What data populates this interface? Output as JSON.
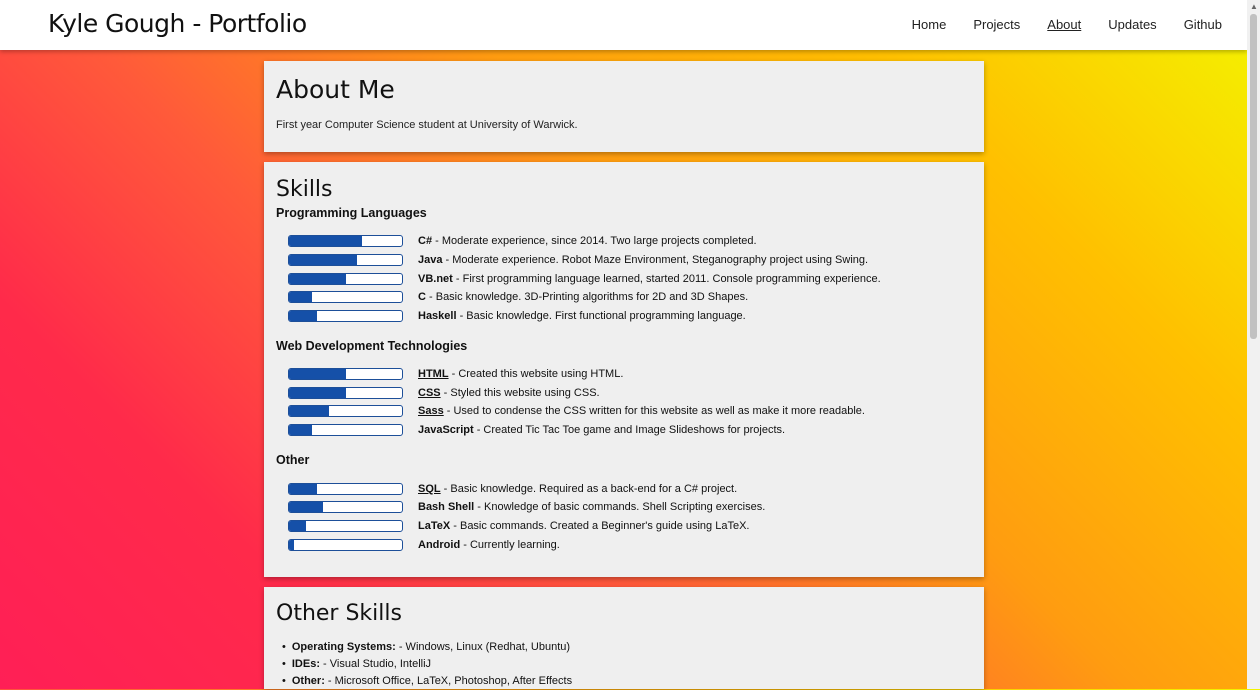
{
  "brand": "Kyle Gough - Portfolio",
  "nav": [
    {
      "label": "Home",
      "active": false
    },
    {
      "label": "Projects",
      "active": false
    },
    {
      "label": "About",
      "active": true
    },
    {
      "label": "Updates",
      "active": false
    },
    {
      "label": "Github",
      "active": false
    }
  ],
  "about": {
    "title": "About Me",
    "text": "First year Computer Science student at University of Warwick."
  },
  "skills": {
    "title": "Skills",
    "groups": [
      {
        "heading": "Programming Languages",
        "items": [
          {
            "name": "C#",
            "desc": " - Moderate experience, since 2014. Two large projects completed.",
            "level": 0.65
          },
          {
            "name": "Java",
            "desc": " - Moderate experience. Robot Maze Environment, Steganography project using Swing.",
            "level": 0.6
          },
          {
            "name": "VB.net",
            "desc": " - First programming language learned, started 2011. Console programming experience.",
            "level": 0.5
          },
          {
            "name": "C",
            "desc": " - Basic knowledge. 3D-Printing algorithms for 2D and 3D Shapes.",
            "level": 0.2
          },
          {
            "name": "Haskell",
            "desc": " - Basic knowledge. First functional programming language.",
            "level": 0.25
          }
        ]
      },
      {
        "heading": "Web Development Technologies",
        "items": [
          {
            "name": "HTML",
            "desc": " - Created this website using HTML.",
            "level": 0.5
          },
          {
            "name": "CSS",
            "desc": " - Styled this website using CSS.",
            "level": 0.5
          },
          {
            "name": "Sass",
            "desc": " - Used to condense the CSS written for this website as well as make it more readable.",
            "level": 0.35
          },
          {
            "name": "JavaScript",
            "desc": " - Created Tic Tac Toe game and Image Slideshows for projects.",
            "level": 0.2
          }
        ]
      },
      {
        "heading": "Other",
        "items": [
          {
            "name": "SQL",
            "desc": " - Basic knowledge. Required as a back-end for a C# project.",
            "level": 0.25
          },
          {
            "name": "Bash Shell",
            "desc": " - Knowledge of basic commands. Shell Scripting exercises.",
            "level": 0.3
          },
          {
            "name": "LaTeX",
            "desc": " - Basic commands. Created a Beginner's guide using LaTeX.",
            "level": 0.15
          },
          {
            "name": "Android",
            "desc": " - Currently learning.",
            "level": 0.04
          }
        ]
      }
    ]
  },
  "other_skills": {
    "title": "Other Skills",
    "items": [
      {
        "label": "Operating Systems:",
        "text": " - Windows, Linux (Redhat, Ubuntu)"
      },
      {
        "label": "IDEs:",
        "text": " - Visual Studio, IntelliJ"
      },
      {
        "label": "Other:",
        "text": " - Microsoft Office, LaTeX, Photoshop, After Effects"
      }
    ]
  },
  "colors": {
    "bar_fill": "#1550a8",
    "bar_border": "#1d4f99",
    "card_bg": "#efefef"
  }
}
